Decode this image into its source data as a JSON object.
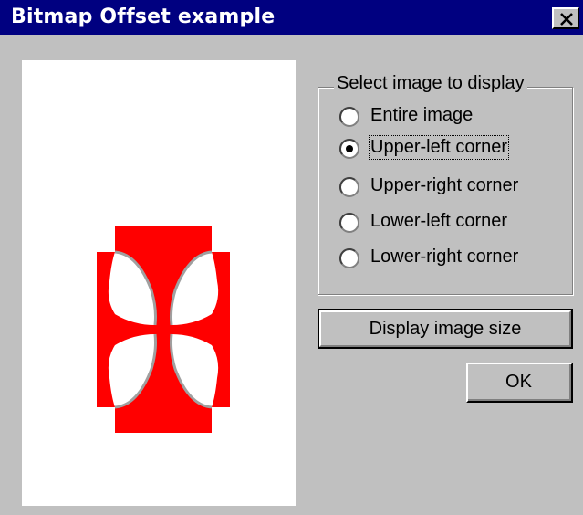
{
  "window": {
    "title": "Bitmap Offset example",
    "close_icon": "close-icon"
  },
  "preview": {
    "image_description_icon": "red-cross-pattee-icon",
    "accent_color": "#ff0000"
  },
  "group": {
    "label": "Select image to display",
    "options": [
      {
        "label": "Entire image",
        "selected": false
      },
      {
        "label": "Upper-left corner",
        "selected": true
      },
      {
        "label": "Upper-right corner",
        "selected": false
      },
      {
        "label": "Lower-left corner",
        "selected": false
      },
      {
        "label": "Lower-right corner",
        "selected": false
      }
    ]
  },
  "buttons": {
    "display_size_label": "Display image size",
    "ok_label": "OK"
  },
  "colors": {
    "titlebar": "#000080",
    "background": "#c0c0c0"
  }
}
